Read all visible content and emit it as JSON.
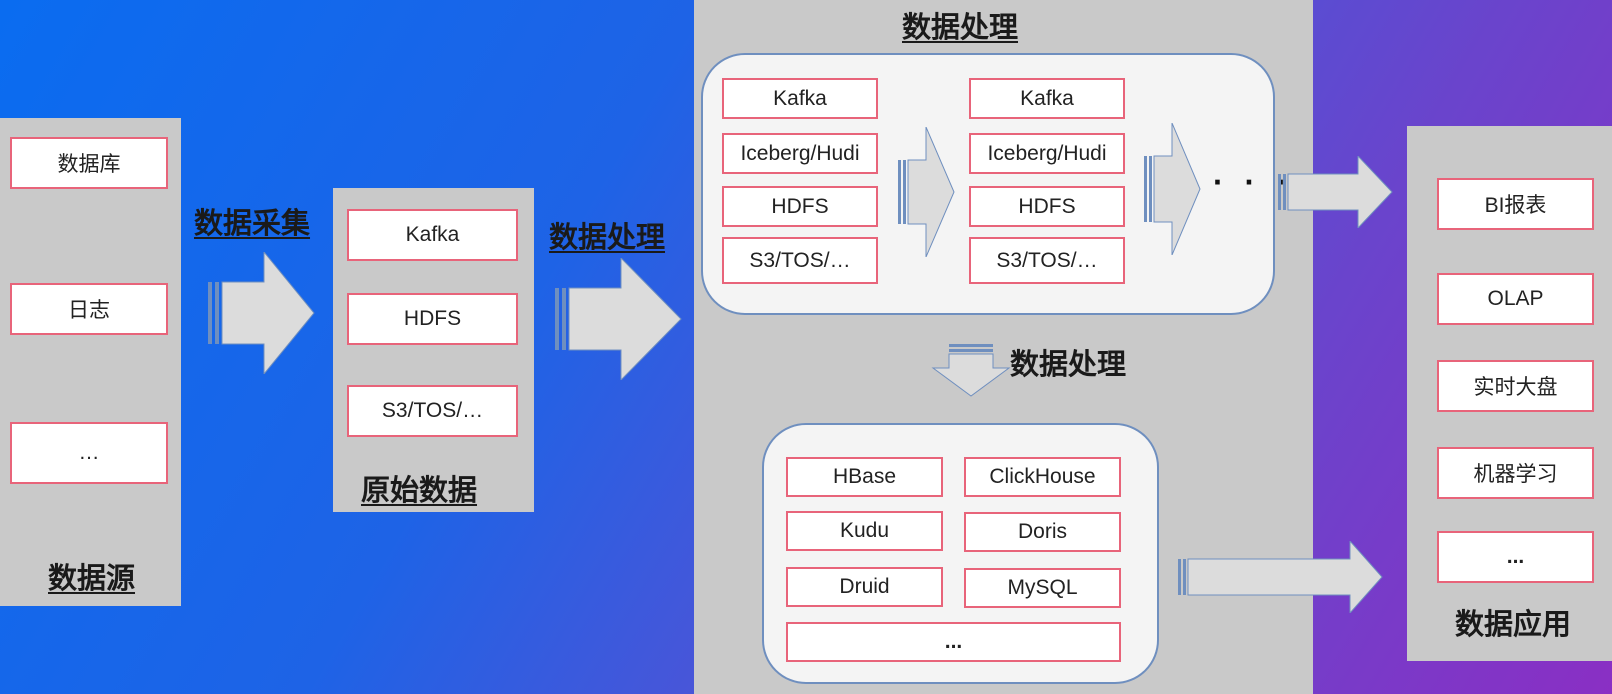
{
  "source": {
    "title": "数据源",
    "items": [
      "数据库",
      "日志",
      "…"
    ]
  },
  "collect": {
    "label": "数据采集"
  },
  "raw": {
    "title": "原始数据",
    "items": [
      "Kafka",
      "HDFS",
      "S3/TOS/…"
    ]
  },
  "process1": {
    "label": "数据处理"
  },
  "processing": {
    "title": "数据处理",
    "col1": [
      "Kafka",
      "Iceberg/Hudi",
      "HDFS",
      "S3/TOS/…"
    ],
    "col2": [
      "Kafka",
      "Iceberg/Hudi",
      "HDFS",
      "S3/TOS/…"
    ],
    "ellipsis": "· · ·",
    "down_label": "数据处理",
    "stores": [
      "HBase",
      "ClickHouse",
      "Kudu",
      "Doris",
      "Druid",
      "MySQL",
      "..."
    ]
  },
  "app": {
    "title": "数据应用",
    "items": [
      "BI报表",
      "OLAP",
      "实时大盘",
      "机器学习",
      "..."
    ]
  },
  "colors": {
    "gradient_start": "#0a6cf0",
    "gradient_end": "#8a2fc4",
    "panel": "#c9c9c9",
    "box_border": "#e8647a",
    "arrow_fill": "#dcdcdc",
    "arrow_stroke": "#6f8fbf"
  }
}
